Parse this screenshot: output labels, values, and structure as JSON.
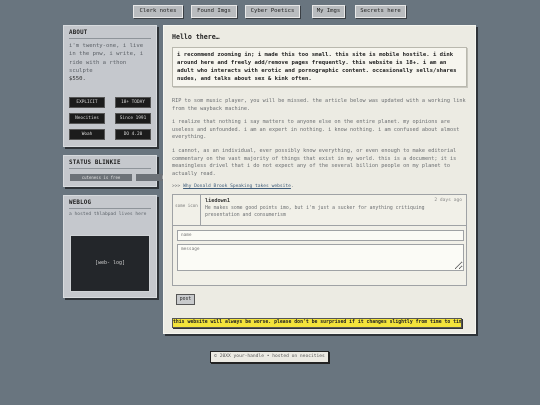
{
  "nav": [
    {
      "label": "Clerk notes"
    },
    {
      "label": "Found Imgs"
    },
    {
      "label": "Cyber Poetics"
    },
    {
      "label": "My Imgs"
    },
    {
      "label": "Secrets here"
    }
  ],
  "about": {
    "title": "ABOUT",
    "text": "i'm twenty-one, i live in the pnw, i write, i ride with a rthon sculpte",
    "price": "$550.",
    "badges": [
      "EXPLICIT",
      "18+ TODAY",
      "Neocities",
      "Since 1991",
      "Woah",
      "DO 4.20"
    ]
  },
  "status": {
    "title": "STATUS BLINKIE",
    "pills": [
      "cuteness is free",
      "Pro-Craft"
    ]
  },
  "weblog": {
    "title": "WEBLOG",
    "text": "a hosted thlabpad lives here",
    "embed_label": "[web- log]"
  },
  "main": {
    "greeting": "Hello there…",
    "notice": "i recommend zooming in; i made this too small. this site is mobile hostile. i dink around here and freely add/remove pages frequently. this website is 18+. i am an adult who interacts with erotic and pornographic content. occasionally sells/shares nudes, and talks about sex & kink often.",
    "para1": "RIP to som music player, you will be missed. the article below was updated with a working link from the wayback machine.",
    "para2": "i realize that nothing i say matters to anyone else on the entire planet. my opinions are useless and unfounded. i am an expert in nothing. i know nothing. i am confused about almost everything.",
    "para3": "i cannot, as an individual, ever possibly know everything, or even enough to make editorial commentary on the vast majority of things that exist in my world. this is a document; it is meaningless drivel that i do not expect any of the several billion people on my planet to actually read.",
    "rss_prefix": ">>> ",
    "rss_link": "Why Donald Brook Speaking takes website",
    "rss_suffix": "."
  },
  "comment": {
    "avatar": "some icon",
    "author": "liedown1",
    "time": "2 days ago",
    "text": "He makes some good points imo, but i'm just a sucker for anything critiquing presentation and consumerism"
  },
  "form": {
    "name_placeholder": "name",
    "message_placeholder": "message",
    "post_label": "post"
  },
  "warning": "this website will always be worse. please don't be surprised if it changes slightly from time to time.",
  "footer": "© 20XX your-handle • hosted on neocities"
}
